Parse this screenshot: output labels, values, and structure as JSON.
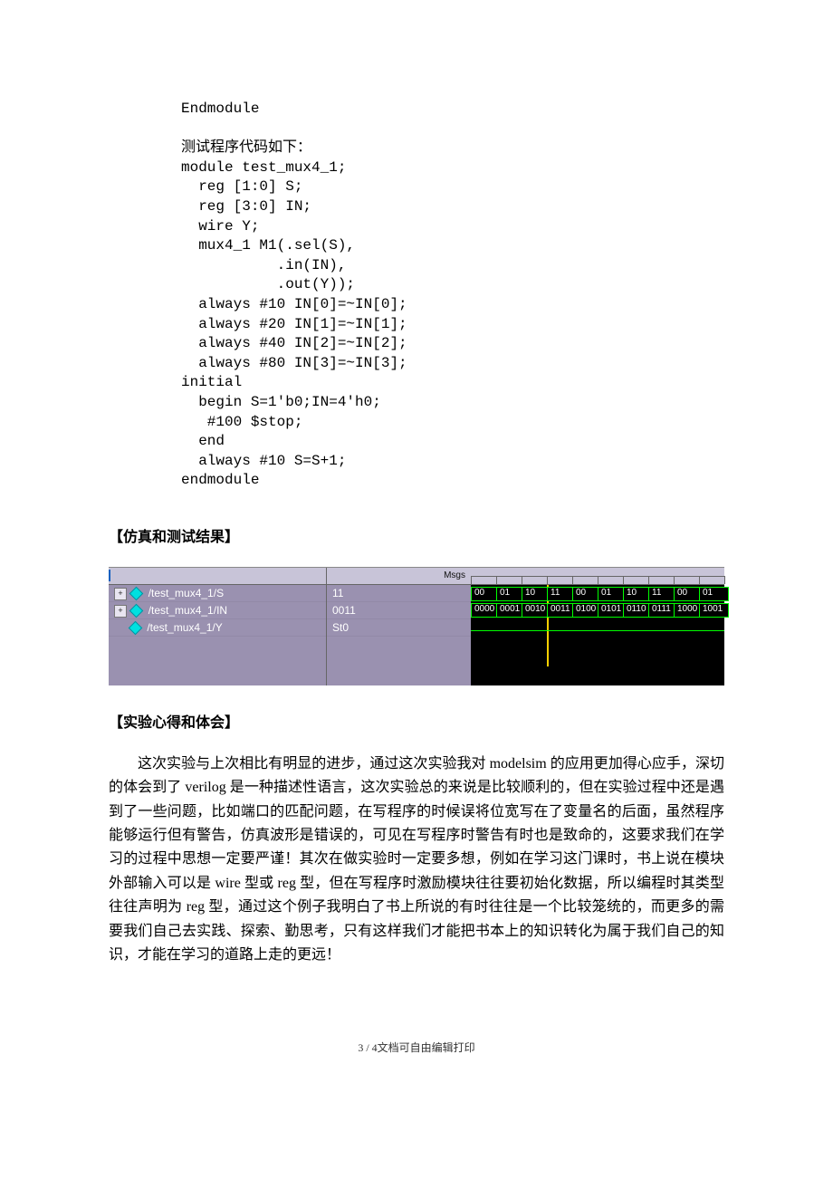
{
  "code": {
    "l0": "Endmodule",
    "blank1": "",
    "l1": "测试程序代码如下：",
    "l2": "module test_mux4_1;",
    "l3": "  reg [1:0] S;",
    "l4": "  reg [3:0] IN;",
    "l5": "  wire Y;",
    "l6": "  mux4_1 M1(.sel(S),",
    "l7": "           .in(IN),",
    "l8": "           .out(Y));",
    "l9": "  always #10 IN[0]=~IN[0];",
    "l10": "  always #20 IN[1]=~IN[1];",
    "l11": "  always #40 IN[2]=~IN[2];",
    "l12": "  always #80 IN[3]=~IN[3];",
    "l13": "initial",
    "l14": "  begin S=1'b0;IN=4'h0;",
    "l15": "   #100 $stop;",
    "l16": "  end",
    "l17": "  always #10 S=S+1;",
    "l18": "endmodule"
  },
  "headings": {
    "sim": "【仿真和测试结果】",
    "exp": "【实验心得和体会】"
  },
  "waveform": {
    "msgs_label": "Msgs",
    "signals": [
      {
        "name": "/test_mux4_1/S",
        "value": "11",
        "expandable": true
      },
      {
        "name": "/test_mux4_1/IN",
        "value": "0011",
        "expandable": true
      },
      {
        "name": "/test_mux4_1/Y",
        "value": "St0",
        "expandable": false
      }
    ],
    "s_row": [
      "00",
      "01",
      "10",
      "11",
      "00",
      "01",
      "10",
      "11",
      "00",
      "01"
    ],
    "in_row": [
      "0000",
      "0001",
      "0010",
      "0011",
      "0100",
      "0101",
      "0110",
      "0111",
      "1000",
      "1001"
    ],
    "cursor_slot": 3
  },
  "body": {
    "text": "这次实验与上次相比有明显的进步，通过这次实验我对 modelsim 的应用更加得心应手，深切的体会到了 verilog 是一种描述性语言，这次实验总的来说是比较顺利的，但在实验过程中还是遇到了一些问题，比如端口的匹配问题，在写程序的时候误将位宽写在了变量名的后面，虽然程序能够运行但有警告，仿真波形是错误的，可见在写程序时警告有时也是致命的，这要求我们在学习的过程中思想一定要严谨！其次在做实验时一定要多想，例如在学习这门课时，书上说在模块外部输入可以是 wire 型或 reg 型，但在写程序时激励模块往往要初始化数据，所以编程时其类型往往声明为 reg 型，通过这个例子我明白了书上所说的有时往往是一个比较笼统的，而更多的需要我们自己去实践、探索、勤思考，只有这样我们才能把书本上的知识转化为属于我们自己的知识，才能在学习的道路上走的更远！"
  },
  "footer": {
    "text": "3 / 4文档可自由编辑打印"
  }
}
